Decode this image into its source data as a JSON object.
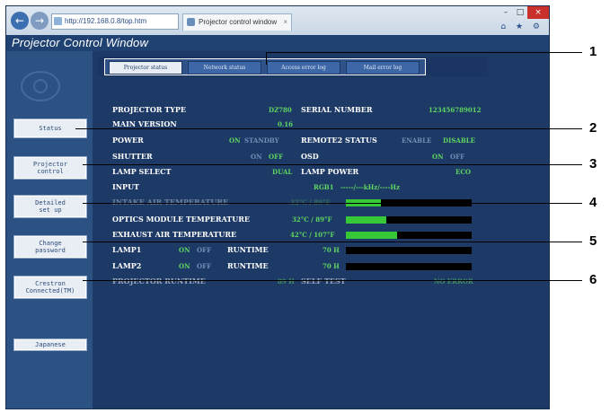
{
  "browser": {
    "address": "http://192.168.0.8/top.htm",
    "address_tools": "⌕ ▾ ≣ ↻",
    "tab_title": "Projector control window",
    "tab_close": "×",
    "back_glyph": "←",
    "forward_glyph": "→",
    "win_min": "–",
    "win_max": "□",
    "win_close": "×",
    "toolbar_icons": "⌂ ★ ⚙"
  },
  "page": {
    "title": "Projector Control Window"
  },
  "sidebar": {
    "buttons": [
      {
        "label": "Status"
      },
      {
        "label": "Projector\ncontrol"
      },
      {
        "label": "Detailed\nset up"
      },
      {
        "label": "Change\npassword"
      },
      {
        "label": "Crestron\nConnected(TM)"
      },
      {
        "label": "Japanese"
      }
    ]
  },
  "tabs": [
    {
      "label": "Projector status",
      "active": true
    },
    {
      "label": "Network status",
      "active": false
    },
    {
      "label": "Access error log",
      "active": false
    },
    {
      "label": "Mail error log",
      "active": false
    }
  ],
  "status": {
    "projector_type": {
      "label": "PROJECTOR TYPE",
      "value": "DZ780"
    },
    "serial_number": {
      "label": "SERIAL NUMBER",
      "value": "123456789012"
    },
    "main_version": {
      "label": "MAIN VERSION",
      "value": "0.16"
    },
    "power": {
      "label": "POWER",
      "on": "ON",
      "standby": "STANDBY"
    },
    "remote2": {
      "label": "REMOTE2 STATUS",
      "enable": "ENABLE",
      "disable": "DISABLE"
    },
    "shutter": {
      "label": "SHUTTER",
      "on": "ON",
      "off": "OFF"
    },
    "osd": {
      "label": "OSD",
      "on": "ON",
      "off": "OFF"
    },
    "lamp_select": {
      "label": "LAMP SELECT",
      "value": "DUAL"
    },
    "lamp_power": {
      "label": "LAMP POWER",
      "value": "ECO"
    },
    "input": {
      "label": "INPUT",
      "value": "RGB1",
      "signal": "-----/---kHz/----Hz"
    },
    "intake_air": {
      "label": "INTAKE AIR TEMPERATURE",
      "value": "32°C / 89°F",
      "level": 0.28
    },
    "optics": {
      "label": "OPTICS MODULE TEMPERATURE",
      "value": "32°C / 89°F",
      "level": 0.32
    },
    "exhaust": {
      "label": "EXHAUST AIR TEMPERATURE",
      "value": "42°C / 107°F",
      "level": 0.41
    },
    "lamp1": {
      "label": "LAMP1",
      "on": "ON",
      "off": "OFF",
      "runtime_label": "RUNTIME",
      "runtime": "70 H"
    },
    "lamp2": {
      "label": "LAMP2",
      "on": "ON",
      "off": "OFF",
      "runtime_label": "RUNTIME",
      "runtime": "70 H"
    },
    "projector_runtime": {
      "label": "PROJECTOR RUNTIME",
      "value": "89 H"
    },
    "self_test": {
      "label": "SELF TEST",
      "value": "NO ERROR"
    }
  },
  "callouts": [
    "1",
    "2",
    "3",
    "4",
    "5",
    "6"
  ]
}
